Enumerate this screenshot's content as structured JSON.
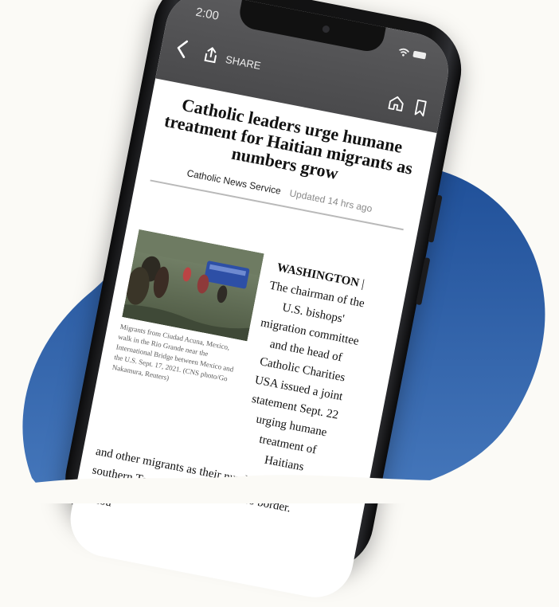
{
  "status_bar": {
    "time": "2:00"
  },
  "toolbar": {
    "share_label": "SHARE"
  },
  "icons": {
    "back": "chevron-left-icon",
    "share": "share-icon",
    "home": "home-icon",
    "bookmark": "bookmark-icon",
    "wifi": "wifi-icon",
    "battery": "battery-icon"
  },
  "article": {
    "headline": "Catholic leaders urge humane treatment for Haitian migrants as numbers grow",
    "source": "Catholic News Service",
    "updated": "Updated 14 hrs ago",
    "photo_caption": "Migrants from Ciudad Acuna, Mexico, walk in the Rio Grande near the International Bridge between Mexico and the U.S. Sept. 17, 2021. (CNS photo/Go Nakamura, Reuters)",
    "dateline": "WASHINGTON",
    "dateline_sep": " |",
    "lede_column": "The chairman of the U.S. bishops' migration committee and the head of Catholic Charities USA issued a joint statement Sept. 22 urging humane treatment of Haitians",
    "lede_continued": "and other migrants as their numbers grow in southern Texas at the U.S.-Mexico border.",
    "next_paragraph_start": "Thou"
  },
  "colors": {
    "background": "#fbfaf6",
    "blob_top": "#1f4f98",
    "blob_bottom": "#3d6fb5",
    "status_bar": "#4e4e50",
    "phone_frame": "#141415"
  }
}
